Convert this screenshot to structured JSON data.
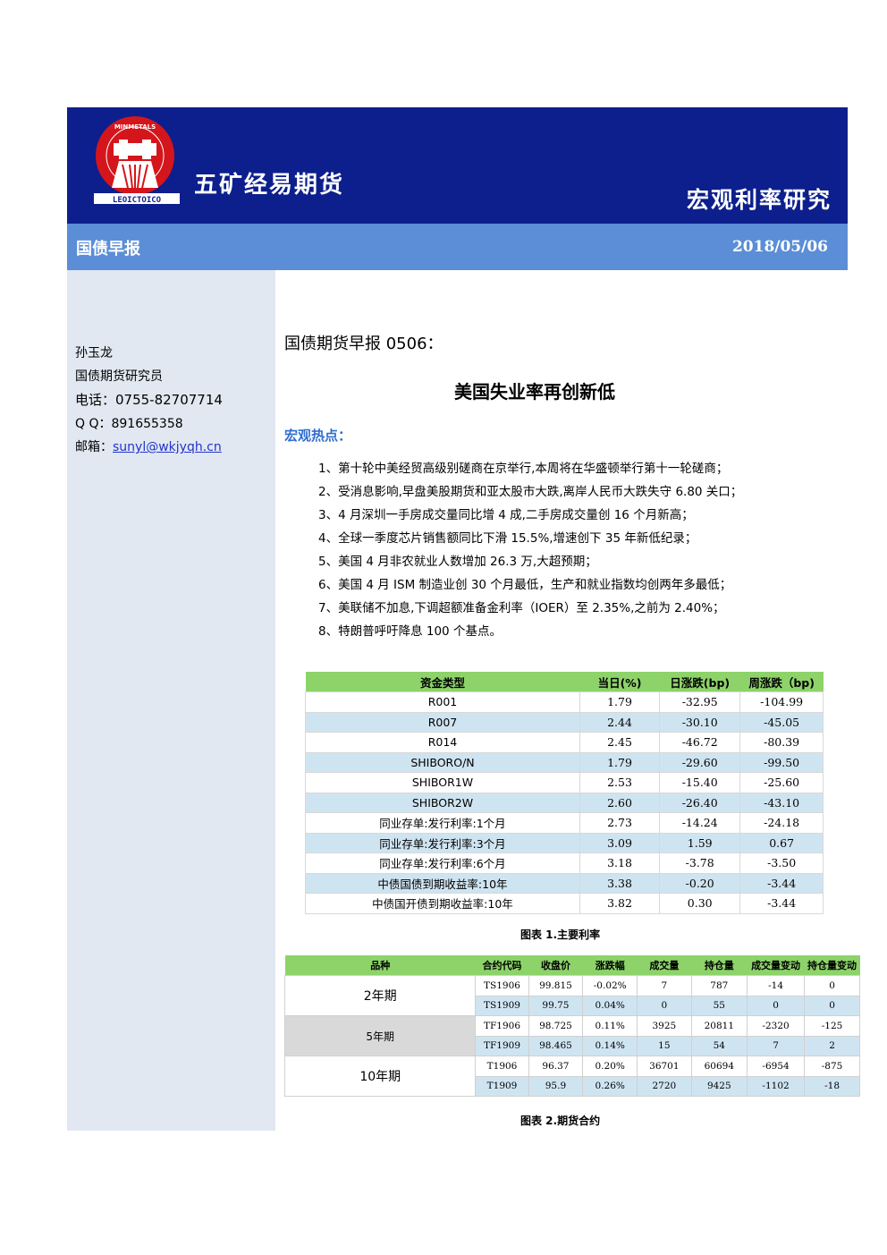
{
  "header": {
    "logo_text": "MINMETALS LEOICTOICO",
    "company": "五矿经易期货",
    "section": "宏观利率研究"
  },
  "subheader": {
    "left": "国债早报",
    "date": "2018/05/06"
  },
  "author": {
    "name": "孙玉龙",
    "role": "国债期货研究员",
    "phone": "电话：0755-82707714",
    "qq": "Q Q：891655358",
    "email_label": "邮箱：",
    "email": "sunyl@wkjyqh.cn"
  },
  "report": {
    "title": "国债期货早报 0506：",
    "headline": "美国失业率再创新低",
    "hot_title": "宏观热点：",
    "news": [
      "1、第十轮中美经贸高级别磋商在京举行,本周将在华盛顿举行第十一轮磋商；",
      "2、受消息影响,早盘美股期货和亚太股市大跌,离岸人民币大跌失守 6.80 关口；",
      "3、4 月深圳一手房成交量同比增 4 成,二手房成交量创 16 个月新高；",
      "4、全球一季度芯片销售额同比下滑 15.5%,增速创下 35 年新低纪录；",
      "5、美国 4 月非农就业人数增加 26.3 万,大超预期；",
      "6、美国 4 月 ISM 制造业创 30 个月最低，生产和就业指数均创两年多最低；",
      "7、美联储不加息,下调超额准备金利率（IOER）至 2.35%,之前为 2.40%；",
      "8、特朗普呼吁降息 100 个基点。"
    ]
  },
  "rates_table": {
    "headers": [
      "资金类型",
      "当日(%)",
      "日涨跌(bp)",
      "周涨跌（bp)"
    ],
    "rows": [
      [
        "R001",
        "1.79",
        "-32.95",
        "-104.99"
      ],
      [
        "R007",
        "2.44",
        "-30.10",
        "-45.05"
      ],
      [
        "R014",
        "2.45",
        "-46.72",
        "-80.39"
      ],
      [
        "SHIBORO/N",
        "1.79",
        "-29.60",
        "-99.50"
      ],
      [
        "SHIBOR1W",
        "2.53",
        "-15.40",
        "-25.60"
      ],
      [
        "SHIBOR2W",
        "2.60",
        "-26.40",
        "-43.10"
      ],
      [
        "同业存单:发行利率:1个月",
        "2.73",
        "-14.24",
        "-24.18"
      ],
      [
        "同业存单:发行利率:3个月",
        "3.09",
        "1.59",
        "0.67"
      ],
      [
        "同业存单:发行利率:6个月",
        "3.18",
        "-3.78",
        "-3.50"
      ],
      [
        "中债国债到期收益率:10年",
        "3.38",
        "-0.20",
        "-3.44"
      ],
      [
        "中债国开债到期收益率:10年",
        "3.82",
        "0.30",
        "-3.44"
      ]
    ],
    "caption": "图表 1.主要利率"
  },
  "futures_table": {
    "headers": [
      "品种",
      "合约代码",
      "收盘价",
      "涨跌幅",
      "成交量",
      "持仓量",
      "成交量变动",
      "持仓量变动"
    ],
    "groups": [
      {
        "variety": "2年期",
        "rows": [
          [
            "TS1906",
            "99.815",
            "-0.02%",
            "7",
            "787",
            "-14",
            "0"
          ],
          [
            "TS1909",
            "99.75",
            "0.04%",
            "0",
            "55",
            "0",
            "0"
          ]
        ]
      },
      {
        "variety": "5年期",
        "rows": [
          [
            "TF1906",
            "98.725",
            "0.11%",
            "3925",
            "20811",
            "-2320",
            "-125"
          ],
          [
            "TF1909",
            "98.465",
            "0.14%",
            "15",
            "54",
            "7",
            "2"
          ]
        ]
      },
      {
        "variety": "10年期",
        "rows": [
          [
            "T1906",
            "96.37",
            "0.20%",
            "36701",
            "60694",
            "-6954",
            "-875"
          ],
          [
            "T1909",
            "95.9",
            "0.26%",
            "2720",
            "9425",
            "-1102",
            "-18"
          ]
        ]
      }
    ],
    "caption": "图表 2.期货合约"
  }
}
